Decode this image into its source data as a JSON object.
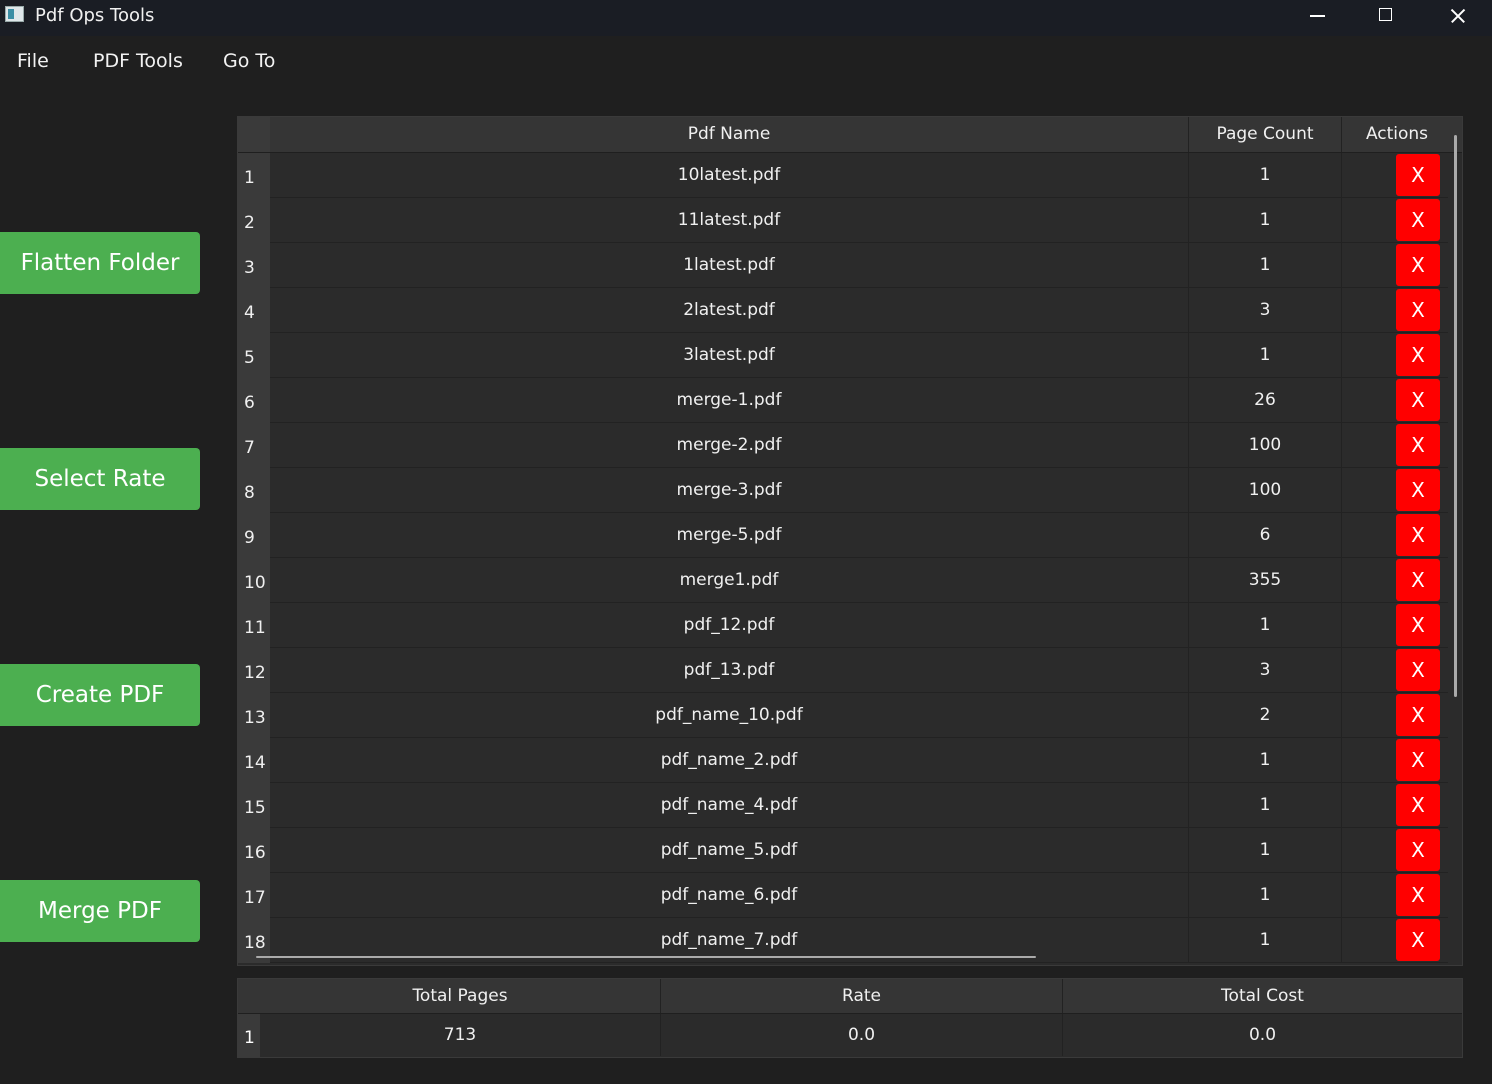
{
  "window": {
    "title": "Pdf Ops Tools"
  },
  "menu": [
    "File",
    "PDF Tools",
    "Go To"
  ],
  "side_buttons": [
    "Flatten Folder",
    "Select Rate",
    "Create PDF",
    "Merge PDF"
  ],
  "table": {
    "headers": [
      "Pdf Name",
      "Page Count",
      "Actions"
    ],
    "action_label": "X",
    "rows": [
      {
        "num": "1",
        "name": "10latest.pdf",
        "pages": "1"
      },
      {
        "num": "2",
        "name": "11latest.pdf",
        "pages": "1"
      },
      {
        "num": "3",
        "name": "1latest.pdf",
        "pages": "1"
      },
      {
        "num": "4",
        "name": "2latest.pdf",
        "pages": "3"
      },
      {
        "num": "5",
        "name": "3latest.pdf",
        "pages": "1"
      },
      {
        "num": "6",
        "name": "merge-1.pdf",
        "pages": "26"
      },
      {
        "num": "7",
        "name": "merge-2.pdf",
        "pages": "100"
      },
      {
        "num": "8",
        "name": "merge-3.pdf",
        "pages": "100"
      },
      {
        "num": "9",
        "name": "merge-5.pdf",
        "pages": "6"
      },
      {
        "num": "10",
        "name": "merge1.pdf",
        "pages": "355"
      },
      {
        "num": "11",
        "name": "pdf_12.pdf",
        "pages": "1"
      },
      {
        "num": "12",
        "name": "pdf_13.pdf",
        "pages": "3"
      },
      {
        "num": "13",
        "name": "pdf_name_10.pdf",
        "pages": "2"
      },
      {
        "num": "14",
        "name": "pdf_name_2.pdf",
        "pages": "1"
      },
      {
        "num": "15",
        "name": "pdf_name_4.pdf",
        "pages": "1"
      },
      {
        "num": "16",
        "name": "pdf_name_5.pdf",
        "pages": "1"
      },
      {
        "num": "17",
        "name": "pdf_name_6.pdf",
        "pages": "1"
      },
      {
        "num": "18",
        "name": "pdf_name_7.pdf",
        "pages": "1"
      }
    ]
  },
  "summary": {
    "headers": [
      "Total Pages",
      "Rate",
      "Total Cost"
    ],
    "row_num": "1",
    "values": [
      "713",
      "0.0",
      "0.0"
    ]
  },
  "colors": {
    "accent_green": "#4caf50",
    "delete_red": "#ff0000",
    "background": "#1f1f1f"
  }
}
